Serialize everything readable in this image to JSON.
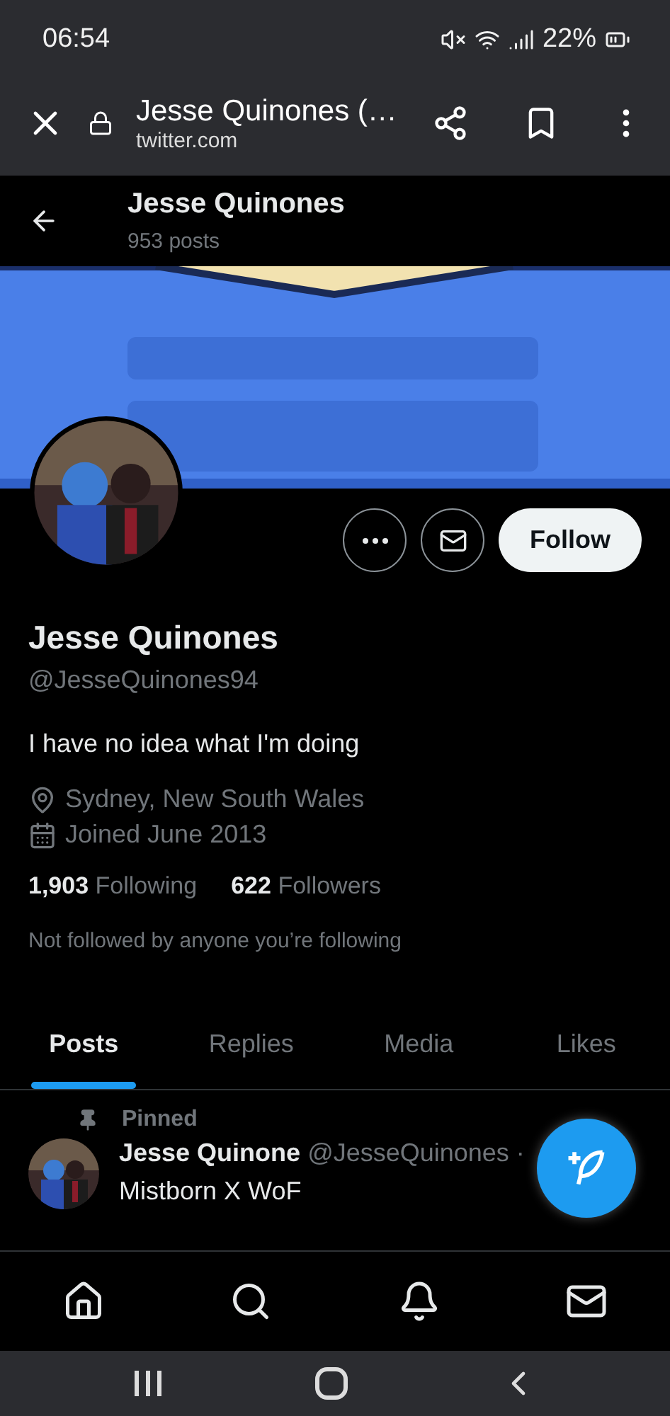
{
  "status_bar": {
    "time": "06:54",
    "battery": "22%"
  },
  "browser_bar": {
    "title": "Jesse Quinones (…",
    "url": "twitter.com"
  },
  "profile_header": {
    "name": "Jesse Quinones",
    "posts": "953 posts"
  },
  "actions": {
    "follow": "Follow"
  },
  "profile": {
    "name": "Jesse Quinones",
    "handle": "@JesseQuinones94",
    "bio": "I have no idea what I'm doing",
    "location": "Sydney, New South Wales",
    "joined": "Joined June 2013",
    "following_count": "1,903",
    "following_label": "Following",
    "followers_count": "622",
    "followers_label": "Followers",
    "followed_by": "Not followed by anyone you’re following"
  },
  "tabs": [
    {
      "label": "Posts",
      "selected": true
    },
    {
      "label": "Replies",
      "selected": false
    },
    {
      "label": "Media",
      "selected": false
    },
    {
      "label": "Likes",
      "selected": false
    }
  ],
  "pinned_post": {
    "pinned_label": "Pinned",
    "name": "Jesse Quinone",
    "handle": "@JesseQuinones ·",
    "text": "Mistborn X WoF"
  }
}
